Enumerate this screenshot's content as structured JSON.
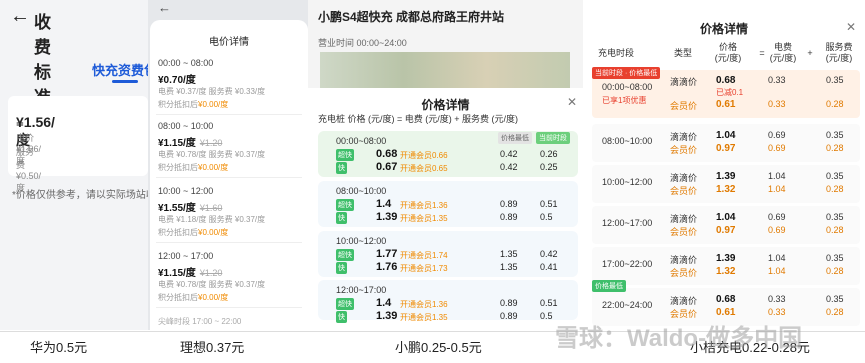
{
  "huawei": {
    "title": "收费标准",
    "tab": "快充资费包",
    "price": "¥1.56/度",
    "electricity": "电价 ¥1.06/度",
    "service": "服务费 ¥0.50/度",
    "note": "*价格仅供参考，请以实际场站收费为准"
  },
  "lixiang": {
    "title": "电价详情",
    "slots": [
      {
        "time": "00:00 ~ 08:00",
        "price": "¥0.70/度",
        "strike": "",
        "detail": "电费 ¥0.37/度  服务费 ¥0.33/度",
        "points": "积分抵扣后",
        "points_val": "¥0.00/度"
      },
      {
        "time": "08:00 ~ 10:00",
        "price": "¥1.15/度",
        "strike": "¥1.20",
        "detail": "电费 ¥0.78/度  服务费 ¥0.37/度",
        "points": "积分抵扣后",
        "points_val": "¥0.00/度"
      },
      {
        "time": "10:00 ~ 12:00",
        "price": "¥1.55/度",
        "strike": "¥1.60",
        "detail": "电费 ¥1.18/度  服务费 ¥0.37/度",
        "points": "积分抵扣后",
        "points_val": "¥0.00/度"
      },
      {
        "time": "12:00 ~ 17:00",
        "price": "¥1.15/度",
        "strike": "¥1.20",
        "detail": "电费 ¥0.78/度  服务费 ¥0.37/度",
        "points": "积分抵扣后",
        "points_val": "¥0.00/度"
      }
    ],
    "more": "尖峰时段 17:00 ~ 22:00"
  },
  "xiaopeng": {
    "station": "小鹏S4超快充 成都总府路王府井站",
    "hours": "营业时间 00:00~24:00",
    "title": "价格详情",
    "header": "充电桩  价格 (元/度)  =  电费 (元/度) + 服务费 (元/度)",
    "groups": [
      {
        "time": "00:00~08:00",
        "tags": [
          "价格最低",
          "当前时段"
        ],
        "rows": [
          {
            "chip": "超快",
            "val": "0.68",
            "kai": "开通会员0.66",
            "e": "0.42",
            "s": "0.26"
          },
          {
            "chip": "快",
            "val": "0.67",
            "kai": "开通会员0.65",
            "e": "0.42",
            "s": "0.25"
          }
        ]
      },
      {
        "time": "08:00~10:00",
        "tags": [],
        "rows": [
          {
            "chip": "超快",
            "val": "1.4",
            "kai": "开通会员1.36",
            "e": "0.89",
            "s": "0.51"
          },
          {
            "chip": "快",
            "val": "1.39",
            "kai": "开通会员1.35",
            "e": "0.89",
            "s": "0.5"
          }
        ]
      },
      {
        "time": "10:00~12:00",
        "tags": [],
        "rows": [
          {
            "chip": "超快",
            "val": "1.77",
            "kai": "开通会员1.74",
            "e": "1.35",
            "s": "0.42"
          },
          {
            "chip": "快",
            "val": "1.76",
            "kai": "开通会员1.73",
            "e": "1.35",
            "s": "0.41"
          }
        ]
      },
      {
        "time": "12:00~17:00",
        "tags": [],
        "rows": [
          {
            "chip": "超快",
            "val": "1.4",
            "kai": "开通会员1.36",
            "e": "0.89",
            "s": "0.51"
          },
          {
            "chip": "快",
            "val": "1.39",
            "kai": "开通会员1.35",
            "e": "0.89",
            "s": "0.5"
          }
        ]
      }
    ]
  },
  "xiaoju": {
    "title": "价格详情",
    "headers": [
      "充电时段",
      "类型",
      "价格\n(元/度)",
      "=",
      "电费\n(元/度)",
      "+",
      "服务费\n(元/度)"
    ],
    "rows": [
      {
        "badge": "当前时段 · 价格最低",
        "time": "00:00~08:00",
        "extra": "已享1项优惠",
        "discount": "已减0.1",
        "a": [
          "滴滴价",
          "0.68",
          "0.33",
          "0.35"
        ],
        "b": [
          "会员价",
          "0.61",
          "0.33",
          "0.28"
        ]
      },
      {
        "badge": "",
        "time": "08:00~10:00",
        "extra": "",
        "discount": "",
        "a": [
          "滴滴价",
          "1.04",
          "0.69",
          "0.35"
        ],
        "b": [
          "会员价",
          "0.97",
          "0.69",
          "0.28"
        ]
      },
      {
        "badge": "",
        "time": "10:00~12:00",
        "extra": "",
        "discount": "",
        "a": [
          "滴滴价",
          "1.39",
          "1.04",
          "0.35"
        ],
        "b": [
          "会员价",
          "1.32",
          "1.04",
          "0.28"
        ]
      },
      {
        "badge": "",
        "time": "12:00~17:00",
        "extra": "",
        "discount": "",
        "a": [
          "滴滴价",
          "1.04",
          "0.69",
          "0.35"
        ],
        "b": [
          "会员价",
          "0.97",
          "0.69",
          "0.28"
        ]
      },
      {
        "badge": "",
        "time": "17:00~22:00",
        "extra": "",
        "discount": "",
        "a": [
          "滴滴价",
          "1.39",
          "1.04",
          "0.35"
        ],
        "b": [
          "会员价",
          "1.32",
          "1.04",
          "0.28"
        ]
      },
      {
        "badge": "价格最低",
        "time": "22:00~24:00",
        "extra": "",
        "discount": "",
        "a": [
          "滴滴价",
          "0.68",
          "0.33",
          "0.35"
        ],
        "b": [
          "会员价",
          "0.61",
          "0.33",
          "0.28"
        ]
      }
    ]
  },
  "captions": {
    "huawei": "华为0.5元",
    "lixiang": "理想0.37元",
    "xiaopeng": "小鹏0.25-0.5元",
    "xiaoju": "小桔充电0.22-0.28元"
  },
  "watermark": "雪球：Waldo-做多中国"
}
